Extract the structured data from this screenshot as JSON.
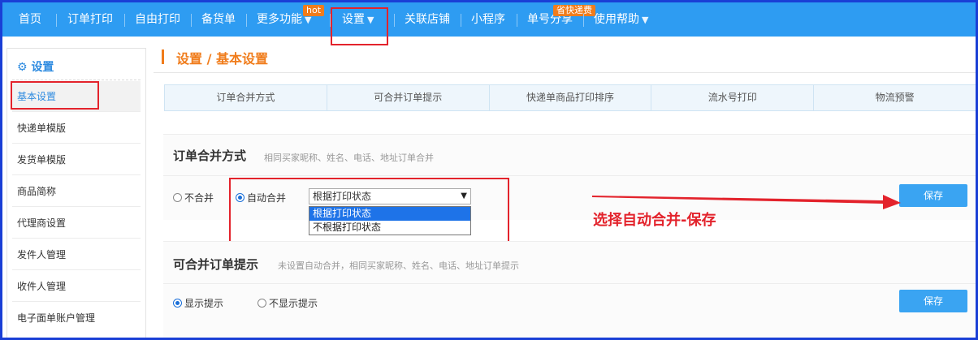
{
  "nav": {
    "items": [
      {
        "label": "首页"
      },
      {
        "label": "订单打印"
      },
      {
        "label": "自由打印"
      },
      {
        "label": "备货单"
      },
      {
        "label": "更多功能"
      },
      {
        "label": "设置"
      },
      {
        "label": "关联店铺"
      },
      {
        "label": "小程序"
      },
      {
        "label": "单号分享"
      },
      {
        "label": "使用帮助"
      }
    ],
    "badge_hot": "hot",
    "badge_save": "省快递费"
  },
  "sidebar": {
    "title": "设置",
    "items": [
      "基本设置",
      "快递单模版",
      "发货单模版",
      "商品简称",
      "代理商设置",
      "发件人管理",
      "收件人管理",
      "电子面单账户管理"
    ]
  },
  "breadcrumb": {
    "text": "设置 / 基本设置"
  },
  "tabs": [
    "订单合并方式",
    "可合并订单提示",
    "快递单商品打印排序",
    "流水号打印",
    "物流预警"
  ],
  "section1": {
    "title": "订单合并方式",
    "desc": "相同买家昵称、姓名、电话、地址订单合并",
    "radio_no_merge": "不合并",
    "radio_auto_merge": "自动合并",
    "select_value": "根据打印状态",
    "options": [
      "根据打印状态",
      "不根据打印状态"
    ],
    "save": "保存"
  },
  "section2": {
    "title": "可合并订单提示",
    "desc": "未设置自动合并，相同买家昵称、姓名、电话、地址订单提示",
    "radio_show": "显示提示",
    "radio_hide": "不显示提示",
    "save": "保存"
  },
  "annotation": {
    "text": "选择自动合并-保存"
  },
  "colors": {
    "nav_bg": "#2e9cf2",
    "accent_orange": "#f07c1b",
    "highlight_red": "#e3232c",
    "button_blue": "#3aa4f2"
  }
}
